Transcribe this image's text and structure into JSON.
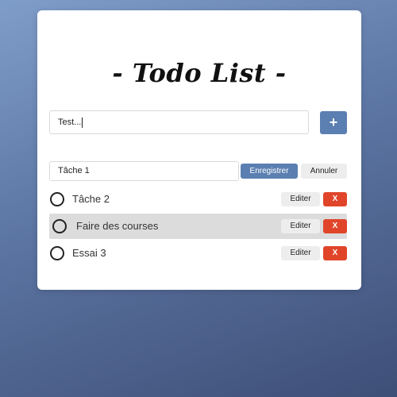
{
  "app": {
    "title": "- Todo List -"
  },
  "new_task": {
    "value": "Test...",
    "add_label": "+"
  },
  "edit_task": {
    "value": "Tâche 1",
    "save_label": "Enregistrer",
    "cancel_label": "Annuler"
  },
  "tasks": [
    {
      "label": "Tâche 2",
      "edit_label": "Editer",
      "delete_label": "X",
      "highlighted": false
    },
    {
      "label": "Faire des courses",
      "edit_label": "Editer",
      "delete_label": "X",
      "highlighted": true
    },
    {
      "label": "Essai 3",
      "edit_label": "Editer",
      "delete_label": "X",
      "highlighted": false
    }
  ],
  "colors": {
    "primary": "#5b7fb1",
    "danger": "#e0452a",
    "highlight": "#dcdcdc"
  }
}
